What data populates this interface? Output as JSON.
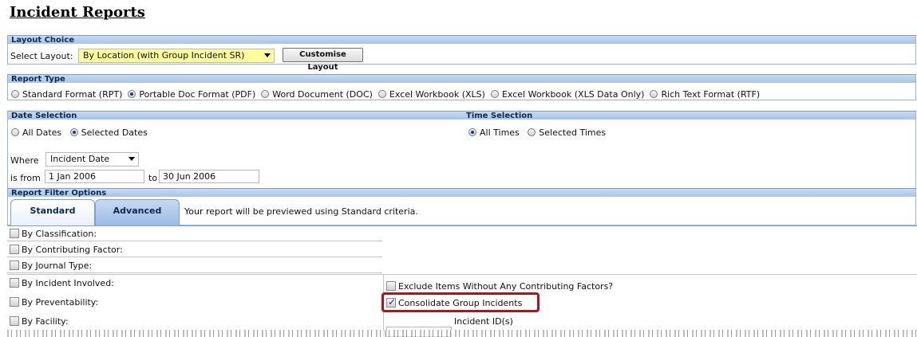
{
  "page_title": "Incident Reports",
  "layout_choice": {
    "header": "Layout Choice",
    "select_label": "Select Layout:",
    "selected_layout": "By Location (with Group Incident SR)",
    "customise_button": "Customise Layout"
  },
  "report_type": {
    "header": "Report Type",
    "options": [
      {
        "label": "Standard Format (RPT)",
        "selected": false
      },
      {
        "label": "Portable Doc Format (PDF)",
        "selected": true
      },
      {
        "label": "Word Document (DOC)",
        "selected": false
      },
      {
        "label": "Excel Workbook (XLS)",
        "selected": false
      },
      {
        "label": "Excel Workbook (XLS Data Only)",
        "selected": false
      },
      {
        "label": "Rich Text Format (RTF)",
        "selected": false
      }
    ]
  },
  "date_selection": {
    "header": "Date Selection",
    "all_dates": "All Dates",
    "selected_dates": "Selected Dates",
    "where_label": "Where",
    "where_value": "Incident Date",
    "from_label": "is from",
    "from_value": "1 Jan 2006",
    "to_label": "to",
    "to_value": "30 Jun 2006"
  },
  "time_selection": {
    "header": "Time Selection",
    "all_times": "All Times",
    "selected_times": "Selected Times"
  },
  "filter_options": {
    "header": "Report Filter Options",
    "tab_standard": "Standard",
    "tab_advanced": "Advanced",
    "preview_note": "Your report will be previewed using Standard criteria.",
    "left_filters": [
      "By Classification:",
      "By Contributing Factor:",
      "By Journal Type:",
      "By Incident Involved:",
      "By Preventability:",
      "By Facility:"
    ],
    "exclude_label": "Exclude Items Without Any Contributing Factors?",
    "consolidate_label": "Consolidate Group Incidents",
    "consolidate_checked": true,
    "incident_id_label": "Incident ID(s)"
  },
  "colors": {
    "header_bar": "#a9c4e8",
    "highlight_border": "#b01224",
    "layout_select_bg": "#fdfd9c"
  }
}
